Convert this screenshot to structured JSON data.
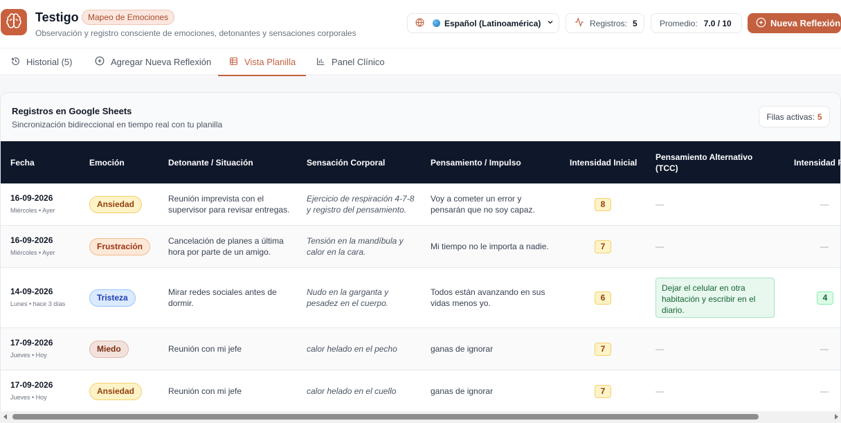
{
  "app": {
    "title": "Testigo",
    "badge": "Mapeo de Emociones",
    "subtitle": "Observación y registro consciente de emociones, detonantes y sensaciones corporales",
    "logo_icon": "brain-icon",
    "accent_color": "#c2603f"
  },
  "header": {
    "language_label": "Español (Latinoamérica)",
    "registros_label": "Registros:",
    "registros_value": "5",
    "promedio_label": "Promedio:",
    "promedio_value": "7.0 / 10",
    "new_button_label": "Nueva Reflexión"
  },
  "tabs": [
    {
      "label": "Historial (5)",
      "icon": "history-icon",
      "active": false
    },
    {
      "label": "Agregar Nueva Reflexión",
      "icon": "plus-circle-icon",
      "active": false
    },
    {
      "label": "Vista Planilla",
      "icon": "table-icon",
      "active": true
    },
    {
      "label": "Panel Clínico",
      "icon": "bar-chart-icon",
      "active": false
    }
  ],
  "sheet": {
    "title": "Registros en Google Sheets",
    "subtitle": "Sincronización bidireccional en tiempo real con tu planilla",
    "active_rows_label": "Filas activas:",
    "active_rows_value": "5"
  },
  "table": {
    "columns": [
      "Fecha",
      "Emoción",
      "Detonante / Situación",
      "Sensación Corporal",
      "Pensamiento / Impulso",
      "Intensidad Inicial",
      "Pensamiento Alternativo (TCC)",
      "Intensidad F"
    ],
    "rows": [
      {
        "date": "16-09-2026",
        "date_sub": "Miércoles • Ayer",
        "emotion": "Ansiedad",
        "trigger": "Reunión imprevista con el supervisor para revisar entregas.",
        "body": "Ejercicio de respiración 4-7-8 y registro del pensamiento.",
        "thought": "Voy a cometer un error y pensarán que no soy capaz.",
        "intensity_initial": "8",
        "alt_thought": "—",
        "intensity_final": "—"
      },
      {
        "date": "16-09-2026",
        "date_sub": "Miércoles • Ayer",
        "emotion": "Frustración",
        "trigger": "Cancelación de planes a última hora por parte de un amigo.",
        "body": "Tensión en la mandíbula y calor en la cara.",
        "thought": "Mi tiempo no le importa a nadie.",
        "intensity_initial": "7",
        "alt_thought": "—",
        "intensity_final": "—"
      },
      {
        "date": "14-09-2026",
        "date_sub": "Lunes • hace 3 días",
        "emotion": "Tristeza",
        "trigger": "Mirar redes sociales antes de dormir.",
        "body": "Nudo en la garganta y pesadez en el cuerpo.",
        "thought": "Todos están avanzando en sus vidas menos yo.",
        "intensity_initial": "6",
        "alt_thought": "Dejar el celular en otra habitación y escribir en el diario.",
        "intensity_final": "4"
      },
      {
        "date": "17-09-2026",
        "date_sub": "Jueves • Hoy",
        "emotion": "Miedo",
        "trigger": "Reunión con mi jefe",
        "body": "calor helado en el pecho",
        "thought": "ganas de ignorar",
        "intensity_initial": "7",
        "alt_thought": "—",
        "intensity_final": "—"
      },
      {
        "date": "17-09-2026",
        "date_sub": "Jueves • Hoy",
        "emotion": "Ansiedad",
        "trigger": "Reunión con mi jefe",
        "body": "calor helado en el cuello",
        "thought": "ganas de ignorar",
        "intensity_initial": "7",
        "alt_thought": "—",
        "intensity_final": "—"
      }
    ]
  },
  "emotion_colors": {
    "Ansiedad": {
      "bg": "#fef3c7",
      "border": "#f3cf6b",
      "text": "#92400e"
    },
    "Frustración": {
      "bg": "#fde8d7",
      "border": "#f3bd8f",
      "text": "#9a3412"
    },
    "Tristeza": {
      "bg": "#dbeafe",
      "border": "#93c5fd",
      "text": "#1e40af"
    },
    "Miedo": {
      "bg": "#f3e2dc",
      "border": "#deb7a9",
      "text": "#7c2d12"
    }
  }
}
